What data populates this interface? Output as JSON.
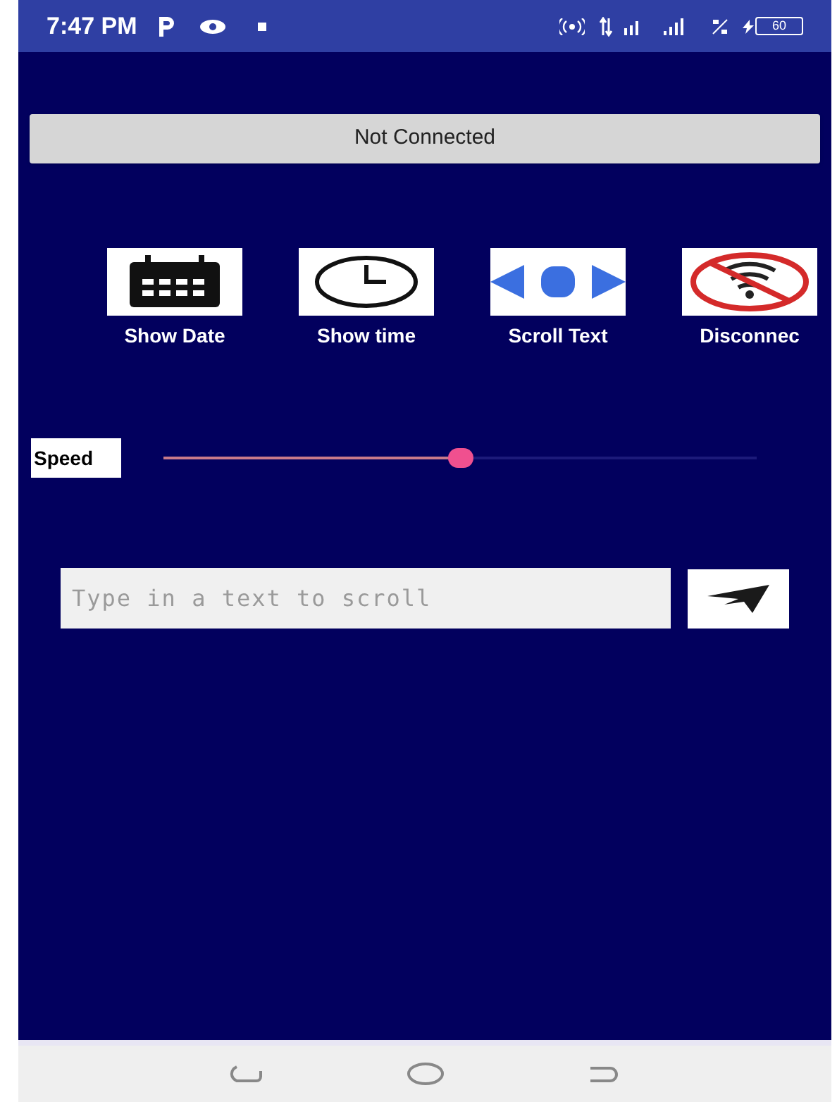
{
  "status_bar": {
    "time": "7:47 PM",
    "battery": "60"
  },
  "connection_button": {
    "label": "Not Connected"
  },
  "actions": [
    {
      "kind": "calendar",
      "label": "Show Date"
    },
    {
      "kind": "clock",
      "label": "Show time"
    },
    {
      "kind": "scroll",
      "label": "Scroll Text"
    },
    {
      "kind": "no-wifi",
      "label": "Disconnec"
    }
  ],
  "speed": {
    "label": "Speed",
    "level": 0.5
  },
  "message": {
    "placeholder": "Type in a text to scroll"
  }
}
